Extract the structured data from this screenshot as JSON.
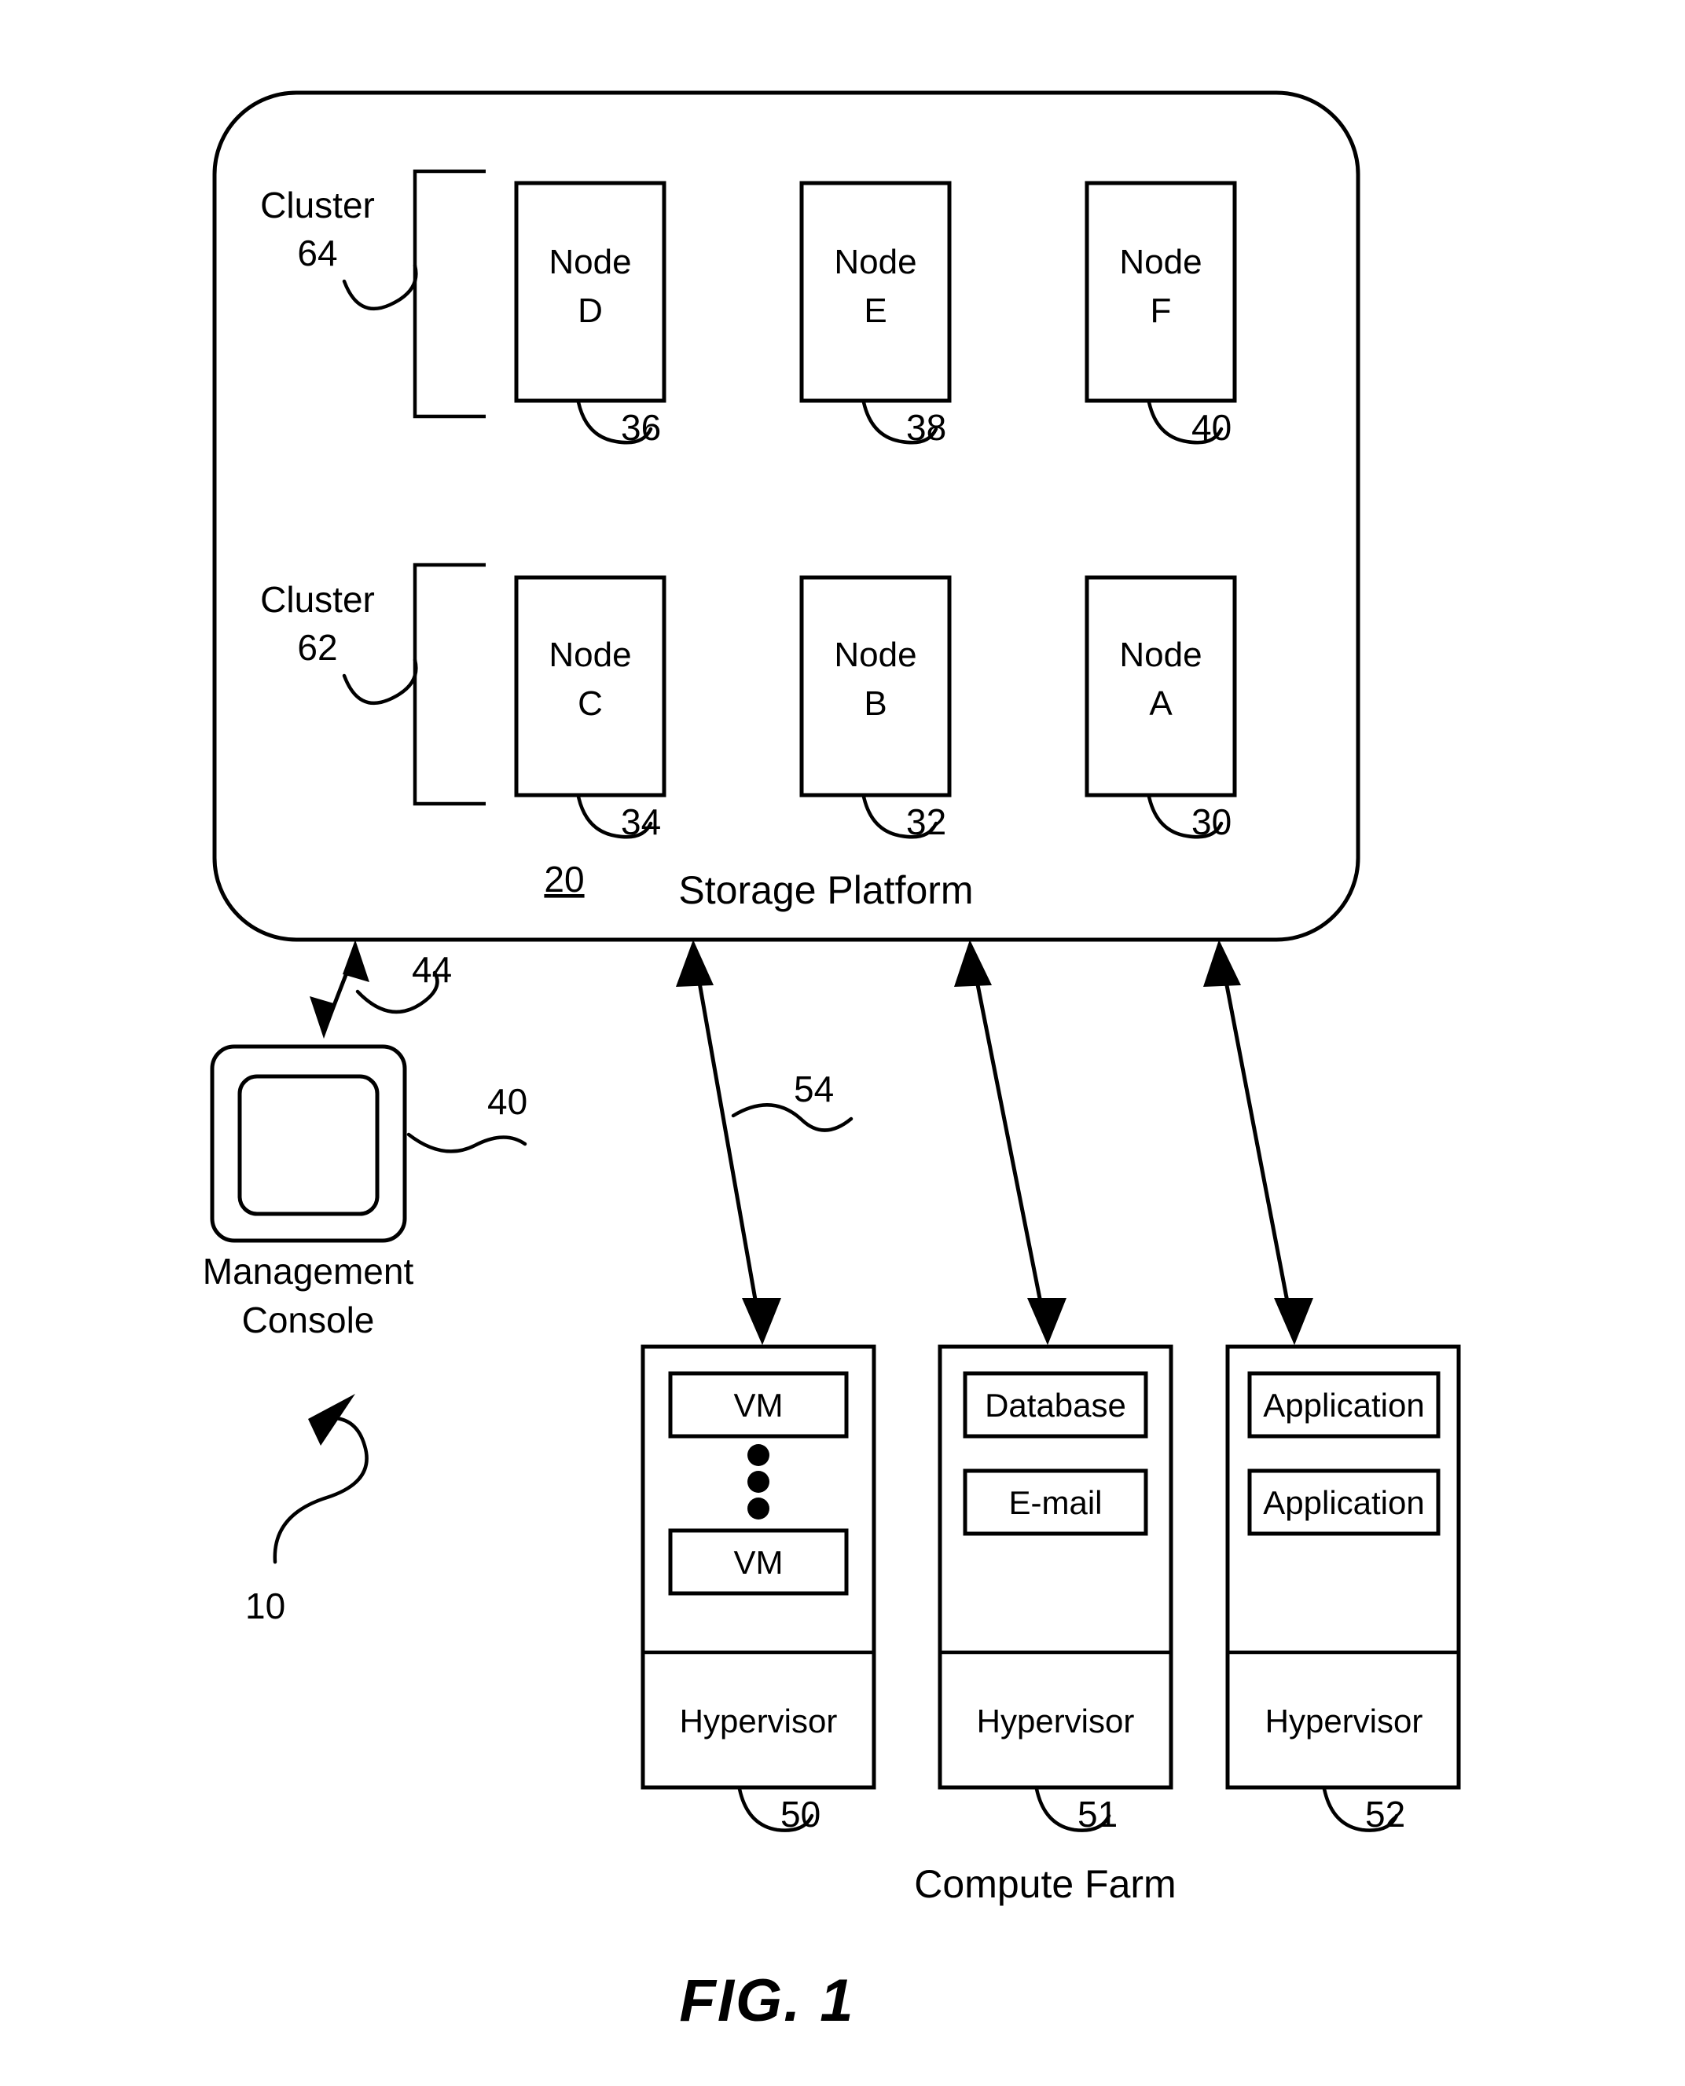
{
  "figure": {
    "caption": "FIG. 1",
    "system_ref": "10"
  },
  "storage_platform": {
    "title": "Storage Platform",
    "ref": "20",
    "clusters": [
      {
        "label": "Cluster",
        "ref": "64"
      },
      {
        "label": "Cluster",
        "ref": "62"
      }
    ],
    "nodes_top": [
      {
        "line1": "Node",
        "line2": "D",
        "ref": "36"
      },
      {
        "line1": "Node",
        "line2": "E",
        "ref": "38"
      },
      {
        "line1": "Node",
        "line2": "F",
        "ref": "40"
      }
    ],
    "nodes_bottom": [
      {
        "line1": "Node",
        "line2": "C",
        "ref": "34"
      },
      {
        "line1": "Node",
        "line2": "B",
        "ref": "32"
      },
      {
        "line1": "Node",
        "line2": "A",
        "ref": "30"
      }
    ]
  },
  "management_console": {
    "label_line1": "Management",
    "label_line2": "Console",
    "ref": "40",
    "link_ref": "44"
  },
  "compute_farm": {
    "title": "Compute Farm",
    "link_ref": "54",
    "hosts": [
      {
        "ref": "50",
        "workloads": [
          "VM",
          "VM"
        ],
        "has_ellipsis": true,
        "hypervisor": "Hypervisor"
      },
      {
        "ref": "51",
        "workloads": [
          "Database",
          "E-mail"
        ],
        "has_ellipsis": false,
        "hypervisor": "Hypervisor"
      },
      {
        "ref": "52",
        "workloads": [
          "Application",
          "Application"
        ],
        "has_ellipsis": false,
        "hypervisor": "Hypervisor"
      }
    ]
  },
  "colors": {
    "ink": "#000000",
    "paper": "#ffffff"
  }
}
